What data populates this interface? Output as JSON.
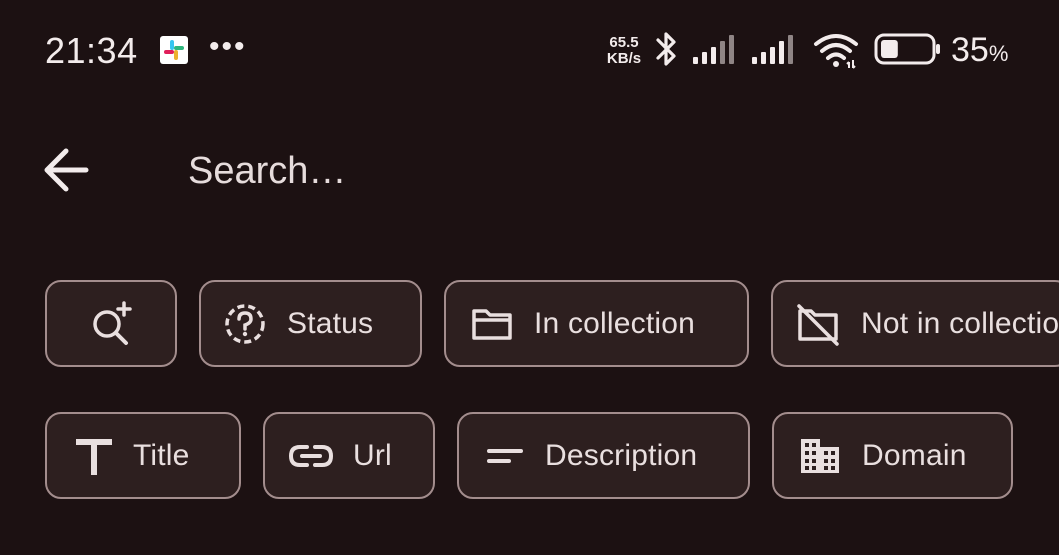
{
  "status_bar": {
    "time": "21:34",
    "more": "•••",
    "net_speed_value": "65.5",
    "net_speed_unit": "KB/s",
    "battery_level": 35,
    "battery_text": "35",
    "battery_unit": "%"
  },
  "toolbar": {
    "search_placeholder": "Search…"
  },
  "filters": {
    "row1": [
      {
        "label": "",
        "icon": "search-plus-icon"
      },
      {
        "label": "Status",
        "icon": "help-circle-dashed-icon"
      },
      {
        "label": "In collection",
        "icon": "folder-icon"
      },
      {
        "label": "Not in collectio",
        "icon": "folder-off-icon"
      }
    ],
    "row2": [
      {
        "label": "Title",
        "icon": "text-t-icon"
      },
      {
        "label": "Url",
        "icon": "link-icon"
      },
      {
        "label": "Description",
        "icon": "short-text-icon"
      },
      {
        "label": "Domain",
        "icon": "domain-building-icon"
      }
    ]
  },
  "colors": {
    "background": "#1c1112",
    "chip_fill": "#2d1f1f",
    "chip_border": "#a38d8d",
    "text": "#e9dfdf"
  }
}
